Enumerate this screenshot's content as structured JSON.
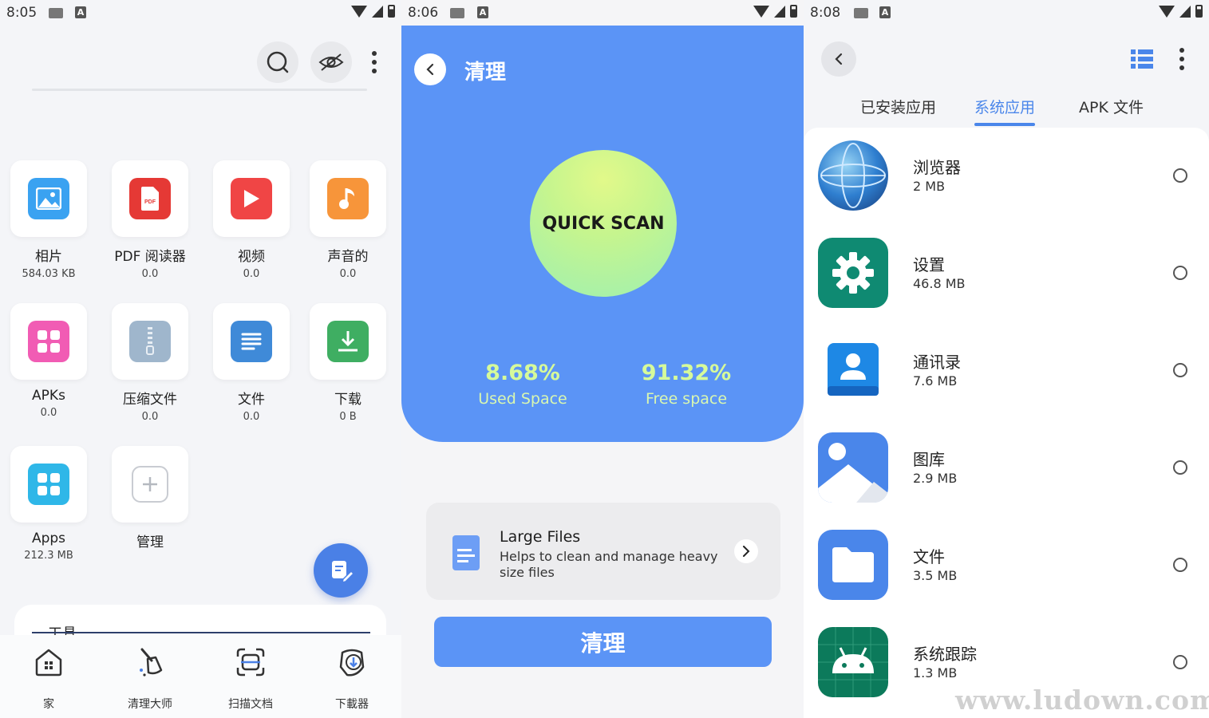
{
  "screen1": {
    "status_time": "8:05",
    "tiles": [
      {
        "label": "相片",
        "sub": "584.03 KB",
        "icon": "image-icon",
        "color": "#3aa2f1"
      },
      {
        "label": "PDF 阅读器",
        "sub": "0.0",
        "icon": "pdf-icon",
        "color": "#e53935"
      },
      {
        "label": "视频",
        "sub": "0.0",
        "icon": "play-icon",
        "color": "#f04545"
      },
      {
        "label": "声音的",
        "sub": "0.0",
        "icon": "music-icon",
        "color": "#f7953a"
      },
      {
        "label": "APKs",
        "sub": "0.0",
        "icon": "apk-grid-icon",
        "color": "#f15cb4"
      },
      {
        "label": "压缩文件",
        "sub": "0.0",
        "icon": "zip-icon",
        "color": "#9fb6cc"
      },
      {
        "label": "文件",
        "sub": "0.0",
        "icon": "document-icon",
        "color": "#3f8ad8"
      },
      {
        "label": "下载",
        "sub": "0 B",
        "icon": "download-icon",
        "color": "#3fae62"
      },
      {
        "label": "Apps",
        "sub": "212.3 MB",
        "icon": "apps-icon",
        "color": "#2fb7e8"
      },
      {
        "label": "管理",
        "sub": "",
        "icon": "plus-icon",
        "color": "#ffffff"
      }
    ],
    "tools_label": "工具",
    "nav": [
      {
        "label": "家",
        "icon": "home-icon"
      },
      {
        "label": "清理大师",
        "icon": "broom-icon"
      },
      {
        "label": "扫描文档",
        "icon": "scan-doc-icon"
      },
      {
        "label": "下載器",
        "icon": "downloader-icon"
      }
    ]
  },
  "screen2": {
    "status_time": "8:06",
    "title": "清理",
    "scan_label": "QUICK SCAN",
    "used_pct": "8.68%",
    "used_label": "Used Space",
    "free_pct": "91.32%",
    "free_label": "Free space",
    "large_files_title": "Large Files",
    "large_files_desc": "Helps to clean and manage heavy size files",
    "clean_button": "清理"
  },
  "screen3": {
    "status_time": "8:08",
    "tabs": [
      "已安装应用",
      "系统应用",
      "APK 文件"
    ],
    "active_tab": 1,
    "apps": [
      {
        "name": "浏览器",
        "size": "2 MB",
        "icon": "globe-icon"
      },
      {
        "name": "设置",
        "size": "46.8 MB",
        "icon": "settings-gear-icon"
      },
      {
        "name": "通讯录",
        "size": "7.6 MB",
        "icon": "contacts-icon"
      },
      {
        "name": "图库",
        "size": "2.9 MB",
        "icon": "gallery-icon"
      },
      {
        "name": "文件",
        "size": "3.5 MB",
        "icon": "folder-icon"
      },
      {
        "name": "系统跟踪",
        "size": "1.3 MB",
        "icon": "android-icon"
      }
    ],
    "watermark": "www.ludown.com"
  }
}
